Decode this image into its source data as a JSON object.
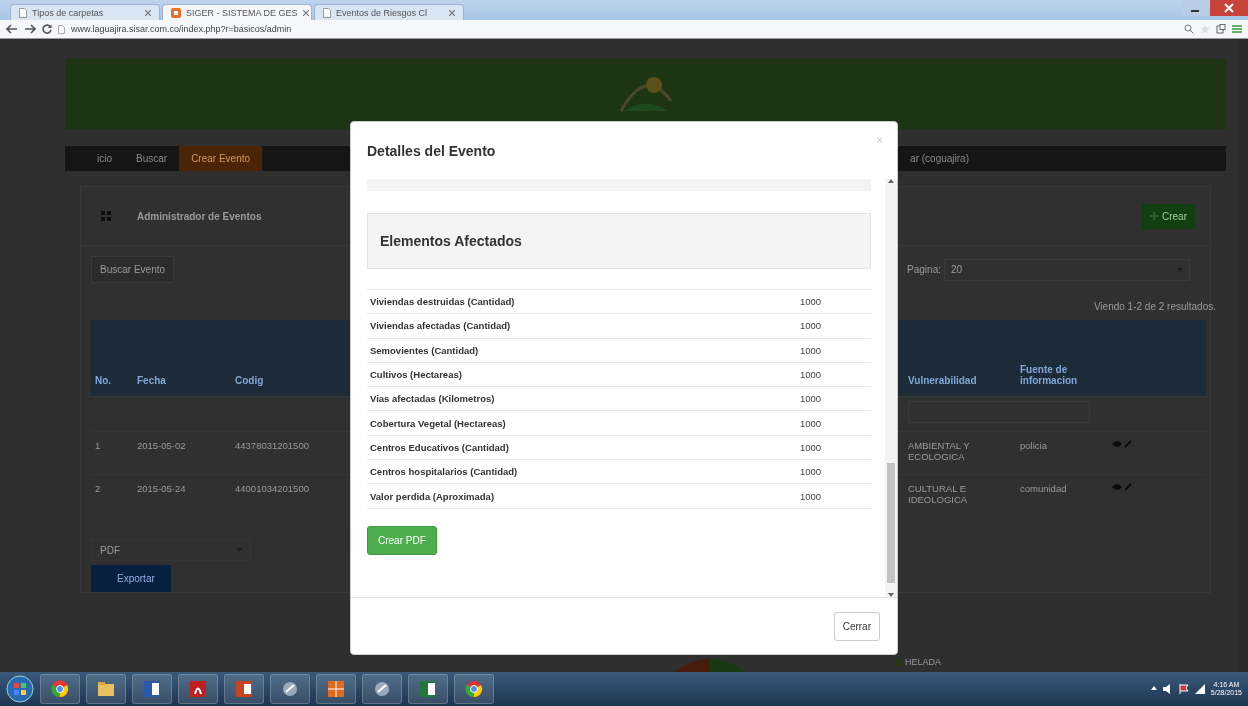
{
  "browser": {
    "tabs": [
      {
        "title": "Tipos de carpetas",
        "selected": false
      },
      {
        "title": "SIGER - SISTEMA DE GES",
        "selected": true
      },
      {
        "title": "Eventos de Riesgos Cl",
        "selected": false
      }
    ],
    "url": "www.laguajira.sisar.com.co/index.php?r=basicos/admin"
  },
  "page": {
    "nav": [
      {
        "label": "icio",
        "selected": false
      },
      {
        "label": "Buscar",
        "selected": false
      },
      {
        "label": "Crear Evento",
        "selected": true
      },
      {
        "label": "ar (coguajira)",
        "selected": false
      }
    ],
    "title": "Administrador de Eventos",
    "create_button": "Crear",
    "search_button": "Buscar Evento",
    "page_size": {
      "label": "Pagina:",
      "value": "20"
    },
    "summary": "Viendo 1-2 de 2 resultados.",
    "table": {
      "columns": [
        "No.",
        "Fecha",
        "Codig",
        "Vulnerabilidad",
        "Fuente de informacion"
      ],
      "rows": [
        [
          "1",
          "2015-05-02",
          "44378031201500",
          "AMBIENTAL Y ECOLOGICA",
          "policia"
        ],
        [
          "2",
          "2015-05-24",
          "44001034201500",
          "CULTURAL E IDEOLOGICA",
          "comunidad"
        ]
      ]
    },
    "export_format": "PDF",
    "export_button": "Exportar",
    "legend": [
      "HELADA"
    ]
  },
  "modal": {
    "title": "Detalles del Evento",
    "close": "×",
    "section": "Elementos Afectados",
    "rows": [
      {
        "label": "Viviendas destruidas (Cantidad)",
        "value": "1000"
      },
      {
        "label": "Viviendas afectadas (Cantidad)",
        "value": "1000"
      },
      {
        "label": "Semovientes (Cantidad)",
        "value": "1000"
      },
      {
        "label": "Cultivos (Hectareas)",
        "value": "1000"
      },
      {
        "label": "Vias afectadas (Kilometros)",
        "value": "1000"
      },
      {
        "label": "Cobertura Vegetal (Hectareas)",
        "value": "1000"
      },
      {
        "label": "Centros Educativos (Cantidad)",
        "value": "1000"
      },
      {
        "label": "Centros hospitalarios (Cantidad)",
        "value": "1000"
      },
      {
        "label": "Valor perdida (Aproximada)",
        "value": "1000"
      }
    ],
    "pdf_button": "Crear PDF",
    "close_button": "Cerrar"
  },
  "taskbar": {
    "time": "4:16 AM",
    "date": "5/28/2015"
  }
}
